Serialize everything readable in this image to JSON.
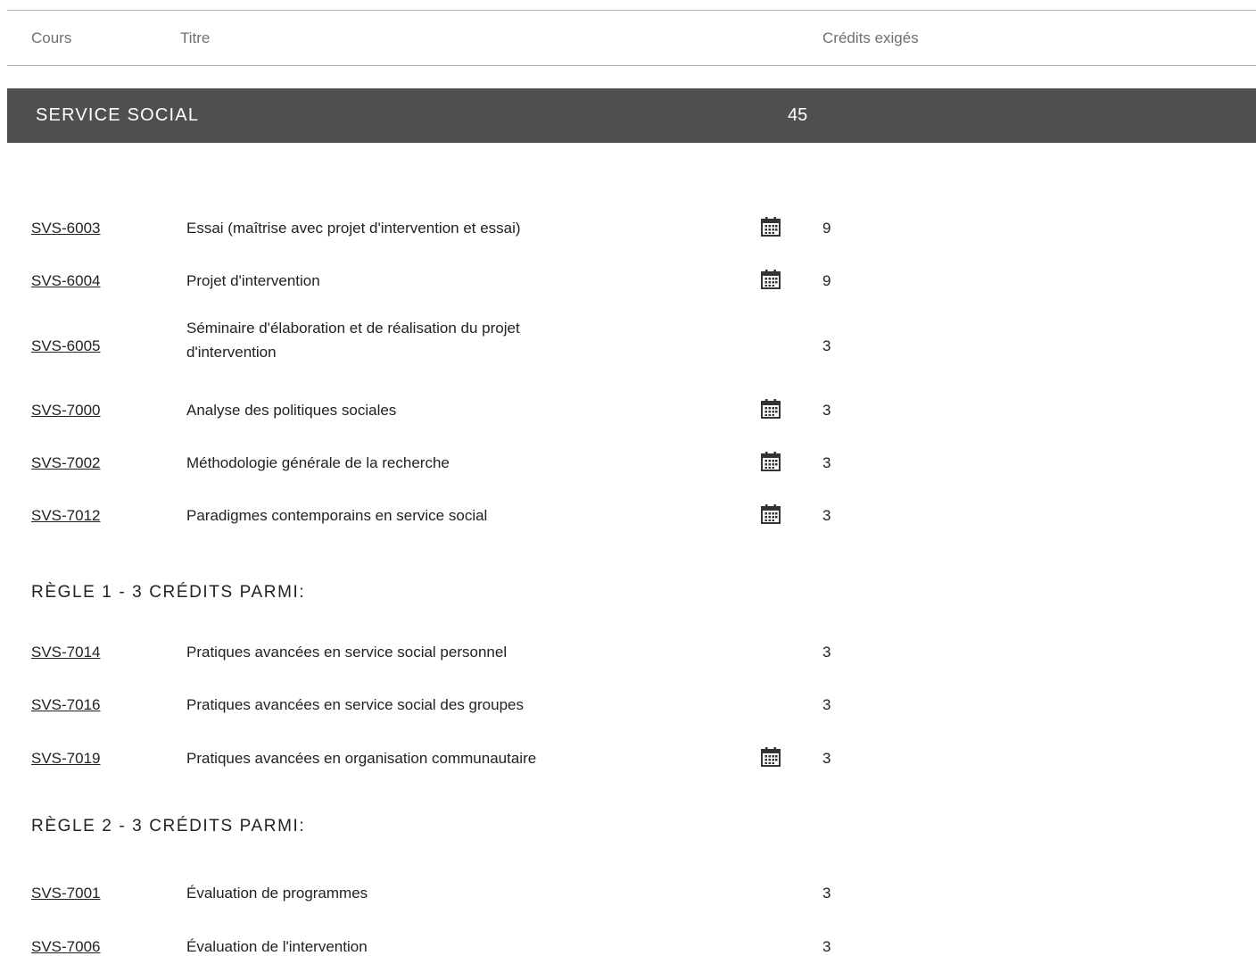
{
  "header": {
    "cours": "Cours",
    "titre": "Titre",
    "credits": "Crédits exigés"
  },
  "section": {
    "title": "SERVICE SOCIAL",
    "credits": "45"
  },
  "required_courses": [
    {
      "code": "SVS-6003",
      "title": "Essai (maîtrise avec projet d'intervention et essai)",
      "credits": "9",
      "calendar": true
    },
    {
      "code": "SVS-6004",
      "title": "Projet d'intervention",
      "credits": "9",
      "calendar": true
    },
    {
      "code": "SVS-6005",
      "title": "Séminaire d'élaboration et de réalisation du projet d'intervention",
      "credits": "3",
      "calendar": false
    },
    {
      "code": "SVS-7000",
      "title": "Analyse des politiques sociales",
      "credits": "3",
      "calendar": true
    },
    {
      "code": "SVS-7002",
      "title": "Méthodologie générale de la recherche",
      "credits": "3",
      "calendar": true
    },
    {
      "code": "SVS-7012",
      "title": "Paradigmes contemporains en service social",
      "credits": "3",
      "calendar": true
    }
  ],
  "rule1": {
    "heading": "RÈGLE 1 - 3 CRÉDITS PARMI:",
    "courses": [
      {
        "code": "SVS-7014",
        "title": "Pratiques avancées en service social personnel",
        "credits": "3",
        "calendar": false
      },
      {
        "code": "SVS-7016",
        "title": "Pratiques avancées en service social des groupes",
        "credits": "3",
        "calendar": false
      },
      {
        "code": "SVS-7019",
        "title": "Pratiques avancées en organisation communautaire",
        "credits": "3",
        "calendar": true
      }
    ]
  },
  "rule2": {
    "heading": "RÈGLE 2 - 3 CRÉDITS PARMI:",
    "courses": [
      {
        "code": "SVS-7001",
        "title": "Évaluation de programmes",
        "credits": "3",
        "calendar": false
      },
      {
        "code": "SVS-7006",
        "title": "Évaluation de l'intervention",
        "credits": "3",
        "calendar": false
      }
    ]
  },
  "icons": {
    "calendar": "calendar-icon"
  }
}
